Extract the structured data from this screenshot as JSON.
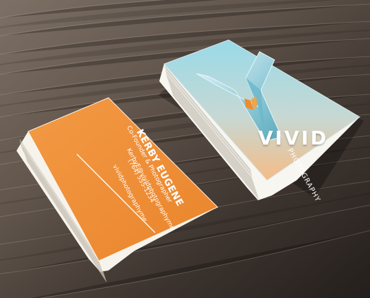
{
  "orange_card": {
    "name": "KERBY EUGENE",
    "role": "Co-Founder & Photographer",
    "phone": "(764) 555-1234",
    "email": "KerbyE@vividphotographyme",
    "website": "vividphotographyme"
  },
  "blue_card": {
    "brand": "VIVID",
    "subtitle": "PHOTOGRAPHY"
  },
  "colors": {
    "orange": "#f08f38",
    "wood_dark": "#2d2824",
    "wood_light": "#7a6d63",
    "blue_top": "#8ed1e0",
    "peach_bottom": "#f7c08f"
  }
}
